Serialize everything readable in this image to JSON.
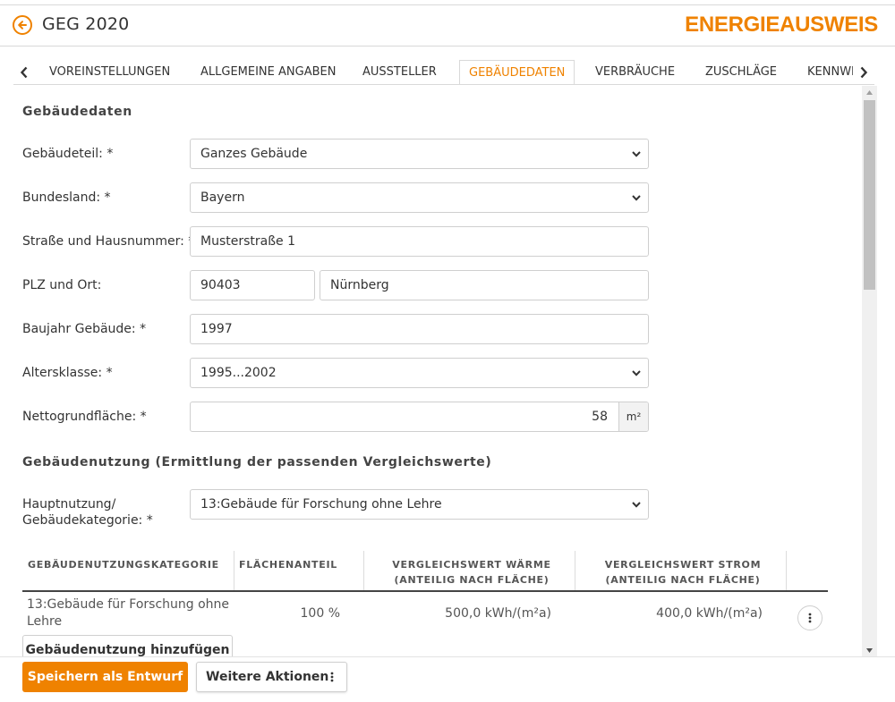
{
  "colors": {
    "accent": "#ef8200",
    "border": "#cfcfcf",
    "text": "#333333"
  },
  "header": {
    "title": "GEG 2020",
    "brand": "ENERGIEAUSWEIS",
    "back_icon": "arrow-left-circle-icon"
  },
  "tabs": [
    {
      "label": "VOREINSTELLUNGEN",
      "active": false
    },
    {
      "label": "ALLGEMEINE ANGABEN",
      "active": false
    },
    {
      "label": "AUSSTELLER",
      "active": false
    },
    {
      "label": "GEBÄUDEDATEN",
      "active": true
    },
    {
      "label": "VERBRÄUCHE",
      "active": false
    },
    {
      "label": "ZUSCHLÄGE",
      "active": false
    },
    {
      "label": "KENNWE",
      "active": false
    }
  ],
  "section1": {
    "title": "Gebäudedaten"
  },
  "form": {
    "gebaeudeteil": {
      "label": "Gebäudeteil: *",
      "value": "Ganzes Gebäude"
    },
    "bundesland": {
      "label": "Bundesland: *",
      "value": "Bayern"
    },
    "strasse": {
      "label": "Straße und Hausnummer: *",
      "value": "Musterstraße 1"
    },
    "plz_ort": {
      "label": "PLZ und Ort:",
      "plz": "90403",
      "ort": "Nürnberg"
    },
    "baujahr": {
      "label": "Baujahr Gebäude: *",
      "value": "1997"
    },
    "altersklasse": {
      "label": "Altersklasse: *",
      "value": "1995...2002"
    },
    "nettogrundflaeche": {
      "label": "Nettogrundfläche: *",
      "value": "58",
      "unit": "m²"
    }
  },
  "section2": {
    "title": "Gebäudenutzung (Ermittlung der passenden Vergleichswerte)"
  },
  "hauptnutzung": {
    "label_line1": "Hauptnutzung/",
    "label_line2": "Gebäudekategorie: *",
    "value": "13:Gebäude für Forschung ohne Lehre"
  },
  "table": {
    "headers": {
      "kategorie": "GEBÄUDENUTZUNGSKATEGORIE",
      "flaechenanteil": "FLÄCHENANTEIL",
      "waerme_line1": "VERGLEICHSWERT WÄRME",
      "waerme_line2": "(ANTEILIG NACH FLÄCHE)",
      "strom_line1": "VERGLEICHSWERT STROM",
      "strom_line2": "(ANTEILIG NACH FLÄCHE)"
    },
    "rows": [
      {
        "kategorie_line1": "13:Gebäude für Forschung ohne",
        "kategorie_line2": "Lehre",
        "flaechenanteil": "100 %",
        "waerme": "500,0 kWh/(m²a)",
        "strom": "400,0 kWh/(m²a)"
      }
    ],
    "add_label": "Gebäudenutzung hinzufügen"
  },
  "footer": {
    "save_label": "Speichern als Entwurf",
    "more_label": "Weitere Aktionen"
  }
}
